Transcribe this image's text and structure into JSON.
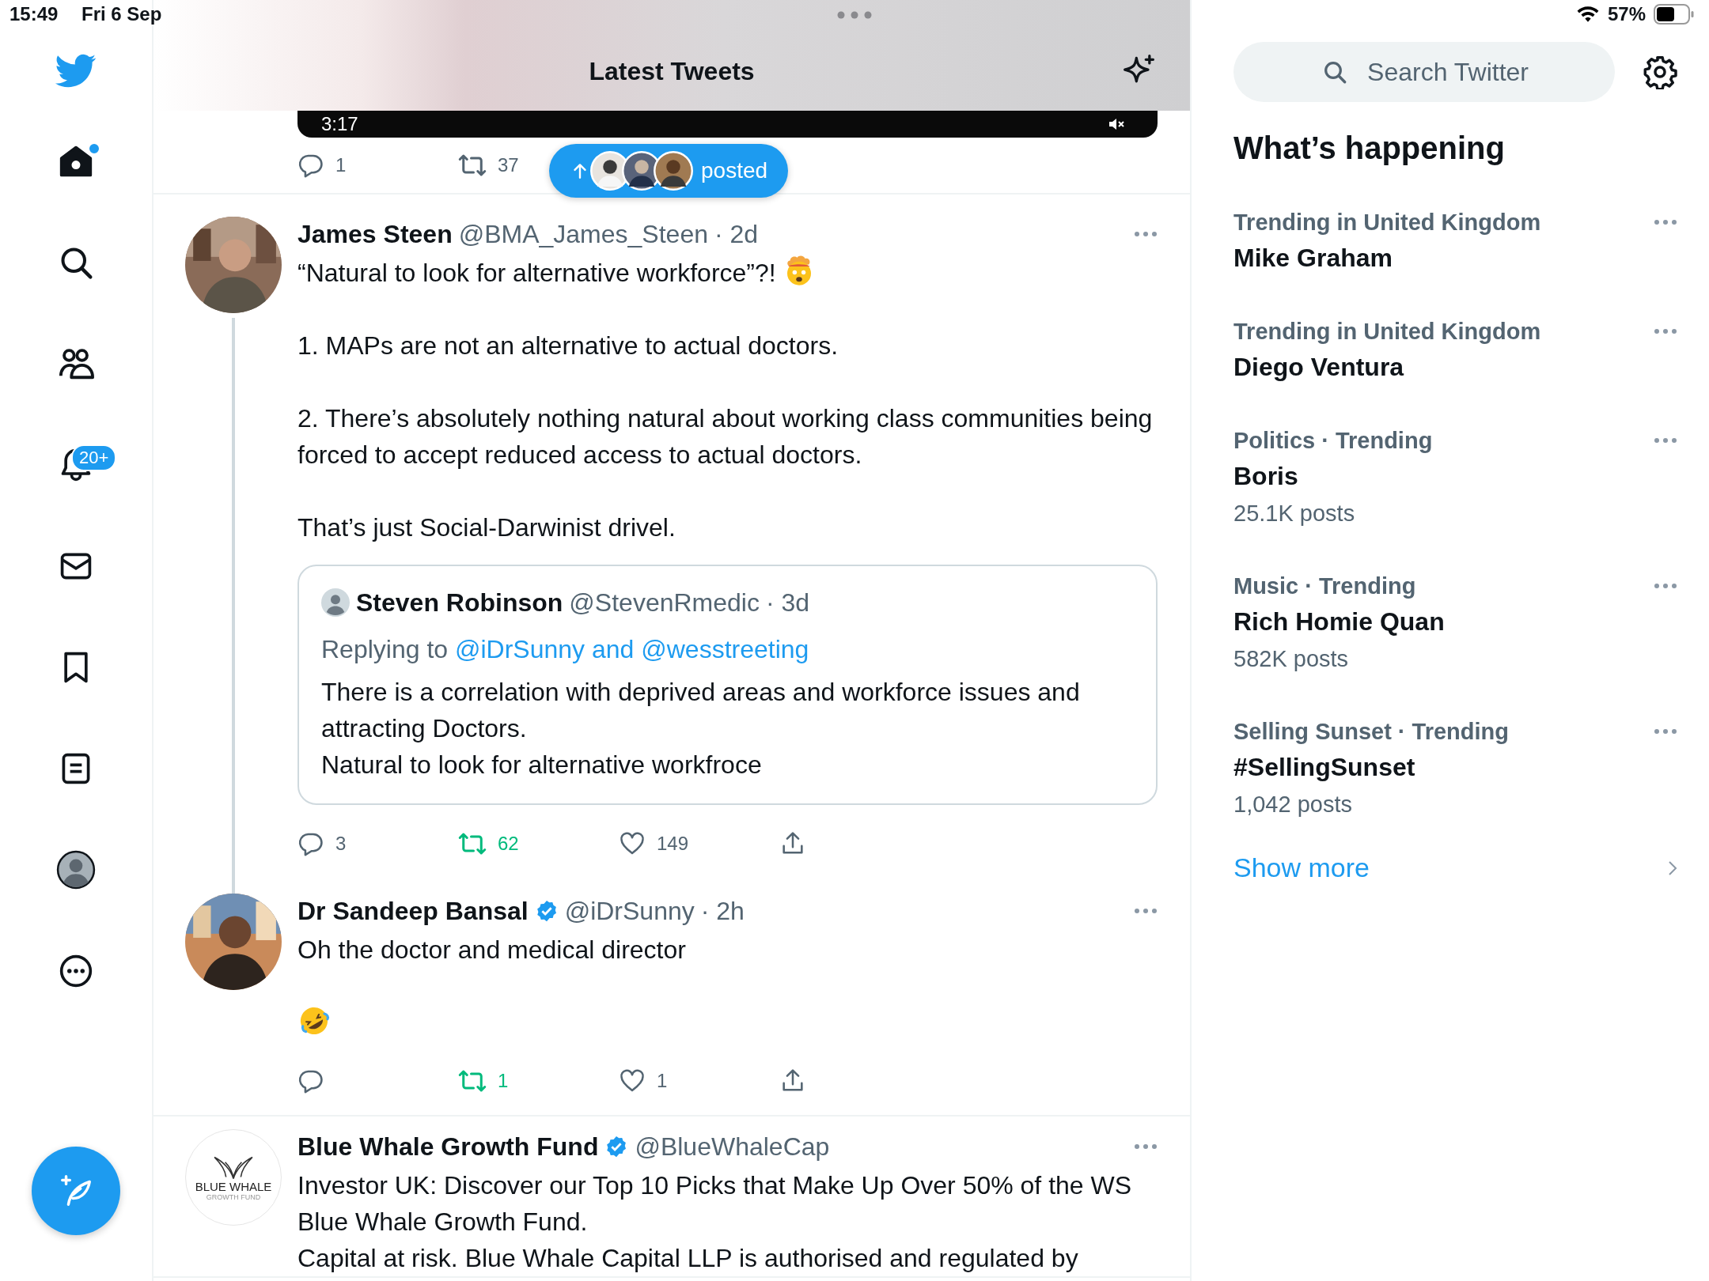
{
  "status_bar": {
    "time": "15:49",
    "date": "Fri 6 Sep",
    "battery": "57%"
  },
  "sidebar": {
    "items": [
      {
        "kind": "home",
        "dot": true
      },
      {
        "kind": "search"
      },
      {
        "kind": "people"
      },
      {
        "kind": "notifications",
        "badge": "20+"
      },
      {
        "kind": "messages"
      },
      {
        "kind": "bookmarks"
      },
      {
        "kind": "lists"
      },
      {
        "kind": "profile"
      },
      {
        "kind": "more"
      }
    ]
  },
  "header": {
    "title": "Latest Tweets"
  },
  "partial_tweet": {
    "video_time": "3:17",
    "actions": [
      {
        "kind": "reply",
        "count": "1"
      },
      {
        "kind": "retweet",
        "count": "37",
        "active": false
      }
    ]
  },
  "new_posts_pill": {
    "label": "posted"
  },
  "tweets": [
    {
      "name": "James Steen",
      "handle": "@BMA_James_Steen",
      "time": "· 2d",
      "avatar": {
        "kind": "picture"
      },
      "thread_continues": true,
      "paragraphs": [
        {
          "kind": "text",
          "text": "“Natural to look for alternative workforce”?!",
          "emoji": {
            "kind": "exploding"
          }
        },
        {
          "kind": "text",
          "text": "1. MAPs are not an alternative to actual doctors."
        },
        {
          "kind": "text",
          "text": "2. There’s absolutely nothing natural about working class communities being forced to accept reduced access to actual doctors."
        },
        {
          "kind": "text",
          "text": "That’s just Social-Darwinist drivel."
        }
      ],
      "quote": {
        "name": "Steven Robinson",
        "handle": "@StevenRmedic",
        "time": "· 3d",
        "replying_label": "Replying to",
        "replying_to": "@iDrSunny and @wesstreeting",
        "lines": [
          "There is a correlation with deprived areas and workforce issues and attracting Doctors.",
          "Natural to look for alternative workfroce"
        ]
      },
      "actions": [
        {
          "kind": "reply",
          "count": "3"
        },
        {
          "kind": "retweet",
          "count": "62",
          "active": true
        },
        {
          "kind": "like",
          "count": "149",
          "active": false
        },
        {
          "kind": "share"
        }
      ]
    },
    {
      "name": "Dr Sandeep Bansal",
      "verified": true,
      "handle": "@iDrSunny",
      "time": "· 2h",
      "avatar": {
        "kind": "picture"
      },
      "paragraphs": [
        {
          "kind": "text",
          "text": "Oh the doctor and medical director"
        },
        {
          "kind": "emoji",
          "emoji": {
            "kind": "rofl"
          }
        }
      ],
      "actions": [
        {
          "kind": "reply"
        },
        {
          "kind": "retweet",
          "count": "1",
          "active": true
        },
        {
          "kind": "like",
          "count": "1",
          "active": false
        },
        {
          "kind": "share"
        }
      ]
    },
    {
      "name": "Blue Whale Growth Fund",
      "verified": true,
      "handle": "@BlueWhaleCap",
      "avatar": {
        "kind": "logo",
        "lines": [
          "BLUE WHALE",
          "GROWTH FUND"
        ]
      },
      "lines": [
        "Investor UK: Discover our Top 10 Picks that Make Up Over 50% of the WS Blue Whale Growth Fund.",
        "Capital at risk. Blue Whale Capital LLP is authorised and regulated by"
      ]
    }
  ],
  "trends": {
    "title": "What’s happening",
    "search_placeholder": "Search Twitter",
    "items": [
      {
        "category": "Trending in United Kingdom",
        "name": "Mike Graham"
      },
      {
        "category": "Trending in United Kingdom",
        "name": "Diego Ventura"
      },
      {
        "category": "Politics · Trending",
        "name": "Boris",
        "posts": "25.1K posts"
      },
      {
        "category": "Music · Trending",
        "name": "Rich Homie Quan",
        "posts": "582K posts"
      },
      {
        "category": "Selling Sunset · Trending",
        "name": "#SellingSunset",
        "posts": "1,042 posts"
      }
    ],
    "show_more": "Show more"
  }
}
